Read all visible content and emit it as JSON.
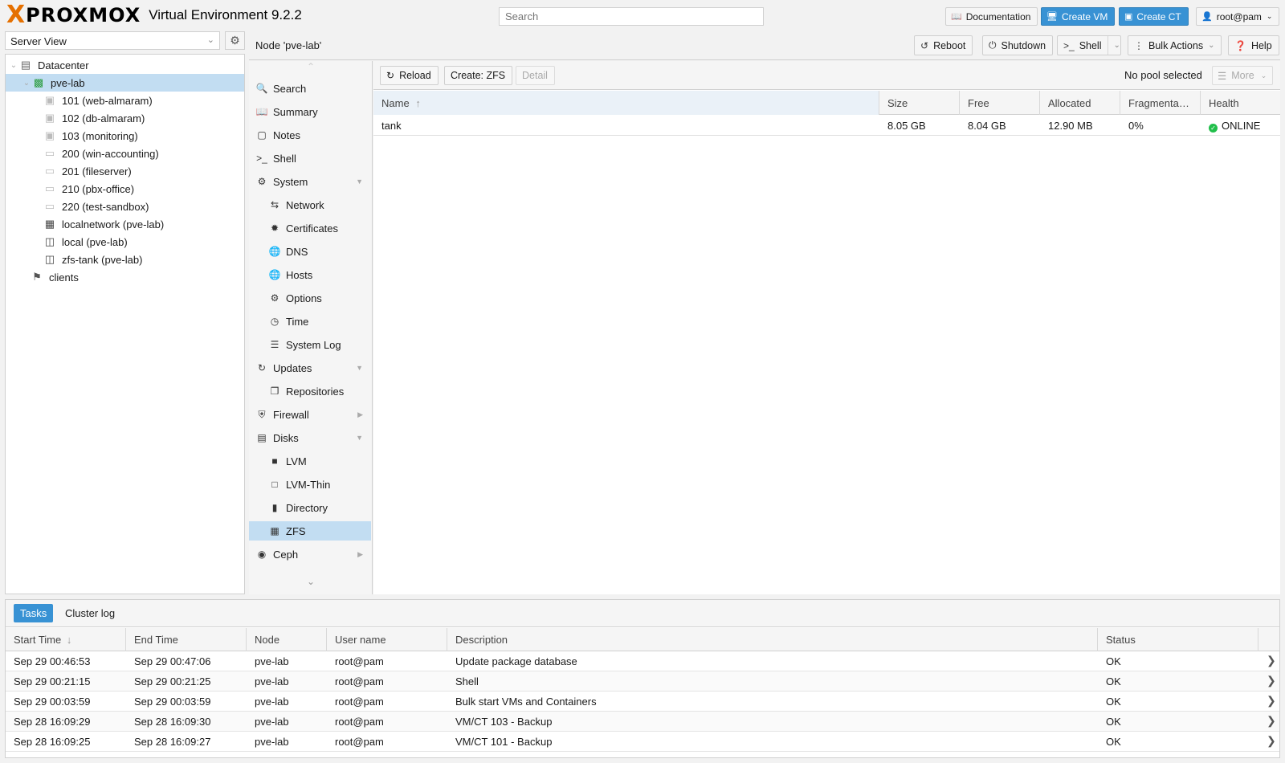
{
  "header": {
    "logo_x": "X",
    "logo_text": "PROXMOX",
    "product": "Virtual Environment 9.2.2",
    "search_placeholder": "Search",
    "buttons": {
      "documentation": "Documentation",
      "create_vm": "Create VM",
      "create_ct": "Create CT",
      "user": "root@pam"
    }
  },
  "left": {
    "view": "Server View",
    "tree": [
      {
        "label": "Datacenter",
        "icon": "server-rack-icon"
      },
      {
        "label": "pve-lab",
        "icon": "node-online-icon"
      },
      {
        "label": "101 (web-almaram)",
        "icon": "container-icon"
      },
      {
        "label": "102 (db-almaram)",
        "icon": "container-icon"
      },
      {
        "label": "103 (monitoring)",
        "icon": "container-icon"
      },
      {
        "label": "200 (win-accounting)",
        "icon": "vm-icon"
      },
      {
        "label": "201 (fileserver)",
        "icon": "vm-icon"
      },
      {
        "label": "210 (pbx-office)",
        "icon": "vm-icon"
      },
      {
        "label": "220 (test-sandbox)",
        "icon": "vm-icon"
      },
      {
        "label": "localnetwork (pve-lab)",
        "icon": "network-grid-icon"
      },
      {
        "label": "local (pve-lab)",
        "icon": "storage-icon"
      },
      {
        "label": "zfs-tank (pve-lab)",
        "icon": "storage-icon"
      },
      {
        "label": "clients",
        "icon": "tags-icon"
      }
    ]
  },
  "nodebar": {
    "title": "Node 'pve-lab'",
    "reboot": "Reboot",
    "shutdown": "Shutdown",
    "shell": "Shell",
    "bulk_actions": "Bulk Actions",
    "help": "Help"
  },
  "submenu": {
    "items": [
      {
        "label": "Search"
      },
      {
        "label": "Summary"
      },
      {
        "label": "Notes"
      },
      {
        "label": "Shell"
      },
      {
        "label": "System"
      },
      {
        "label": "Network"
      },
      {
        "label": "Certificates"
      },
      {
        "label": "DNS"
      },
      {
        "label": "Hosts"
      },
      {
        "label": "Options"
      },
      {
        "label": "Time"
      },
      {
        "label": "System Log"
      },
      {
        "label": "Updates"
      },
      {
        "label": "Repositories"
      },
      {
        "label": "Firewall"
      },
      {
        "label": "Disks"
      },
      {
        "label": "LVM"
      },
      {
        "label": "LVM-Thin"
      },
      {
        "label": "Directory"
      },
      {
        "label": "ZFS"
      },
      {
        "label": "Ceph"
      }
    ]
  },
  "zfs": {
    "toolbar": {
      "reload": "Reload",
      "create": "Create: ZFS",
      "detail": "Detail",
      "status": "No pool selected",
      "more": "More"
    },
    "columns": [
      "Name",
      "Size",
      "Free",
      "Allocated",
      "Fragmenta…",
      "Health"
    ],
    "rows": [
      {
        "name": "tank",
        "size": "8.05 GB",
        "free": "8.04 GB",
        "allocated": "12.90 MB",
        "frag": "0%",
        "health": "ONLINE"
      }
    ]
  },
  "tasks": {
    "tabs": [
      "Tasks",
      "Cluster log"
    ],
    "columns": [
      "Start Time",
      "End Time",
      "Node",
      "User name",
      "Description",
      "Status"
    ],
    "rows": [
      {
        "start": "Sep 29 00:46:53",
        "end": "Sep 29 00:47:06",
        "node": "pve-lab",
        "user": "root@pam",
        "desc": "Update package database",
        "status": "OK"
      },
      {
        "start": "Sep 29 00:21:15",
        "end": "Sep 29 00:21:25",
        "node": "pve-lab",
        "user": "root@pam",
        "desc": "Shell",
        "status": "OK"
      },
      {
        "start": "Sep 29 00:03:59",
        "end": "Sep 29 00:03:59",
        "node": "pve-lab",
        "user": "root@pam",
        "desc": "Bulk start VMs and Containers",
        "status": "OK"
      },
      {
        "start": "Sep 28 16:09:29",
        "end": "Sep 28 16:09:30",
        "node": "pve-lab",
        "user": "root@pam",
        "desc": "VM/CT 103 - Backup",
        "status": "OK"
      },
      {
        "start": "Sep 28 16:09:25",
        "end": "Sep 28 16:09:27",
        "node": "pve-lab",
        "user": "root@pam",
        "desc": "VM/CT 101 - Backup",
        "status": "OK"
      }
    ]
  },
  "colors": {
    "accent": "#3892d4",
    "selection": "#c2ddf2",
    "logo_orange": "#e57000",
    "online_green": "#21bf4b"
  }
}
